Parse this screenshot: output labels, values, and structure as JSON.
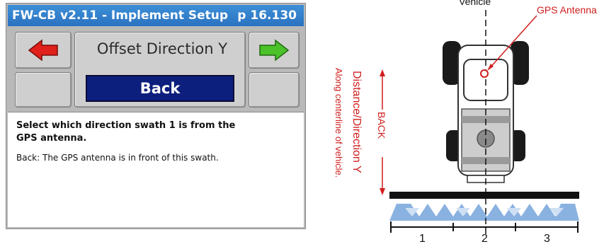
{
  "device": {
    "title": "FW-CB v2.11 - Implement Setup",
    "page": "p 16.130",
    "screen_title": "Offset Direction Y",
    "back_label": "Back",
    "description_bold": "Select which direction swath 1 is from the GPS antenna.",
    "description_text": "Back: The GPS antenna is in front of this swath.",
    "prev_icon": "left-arrow-icon",
    "next_icon": "right-arrow-icon",
    "colors": {
      "title_bar": "#2f7fd0",
      "back_button": "#0c1f7d",
      "prev_arrow": "#e0201a",
      "next_arrow": "#4bc12a"
    }
  },
  "diagram": {
    "vehicle_label": "Vehicle",
    "gps_label": "GPS Antenna",
    "back_label": "BACK",
    "distance_label": "Distance/Direction Y",
    "centerline_label": "Along centerline of vehicle.",
    "swath_numbers": [
      "1",
      "2",
      "3"
    ],
    "colors": {
      "annotation": "#d01e1e",
      "spray": "#8ab2e0"
    }
  }
}
